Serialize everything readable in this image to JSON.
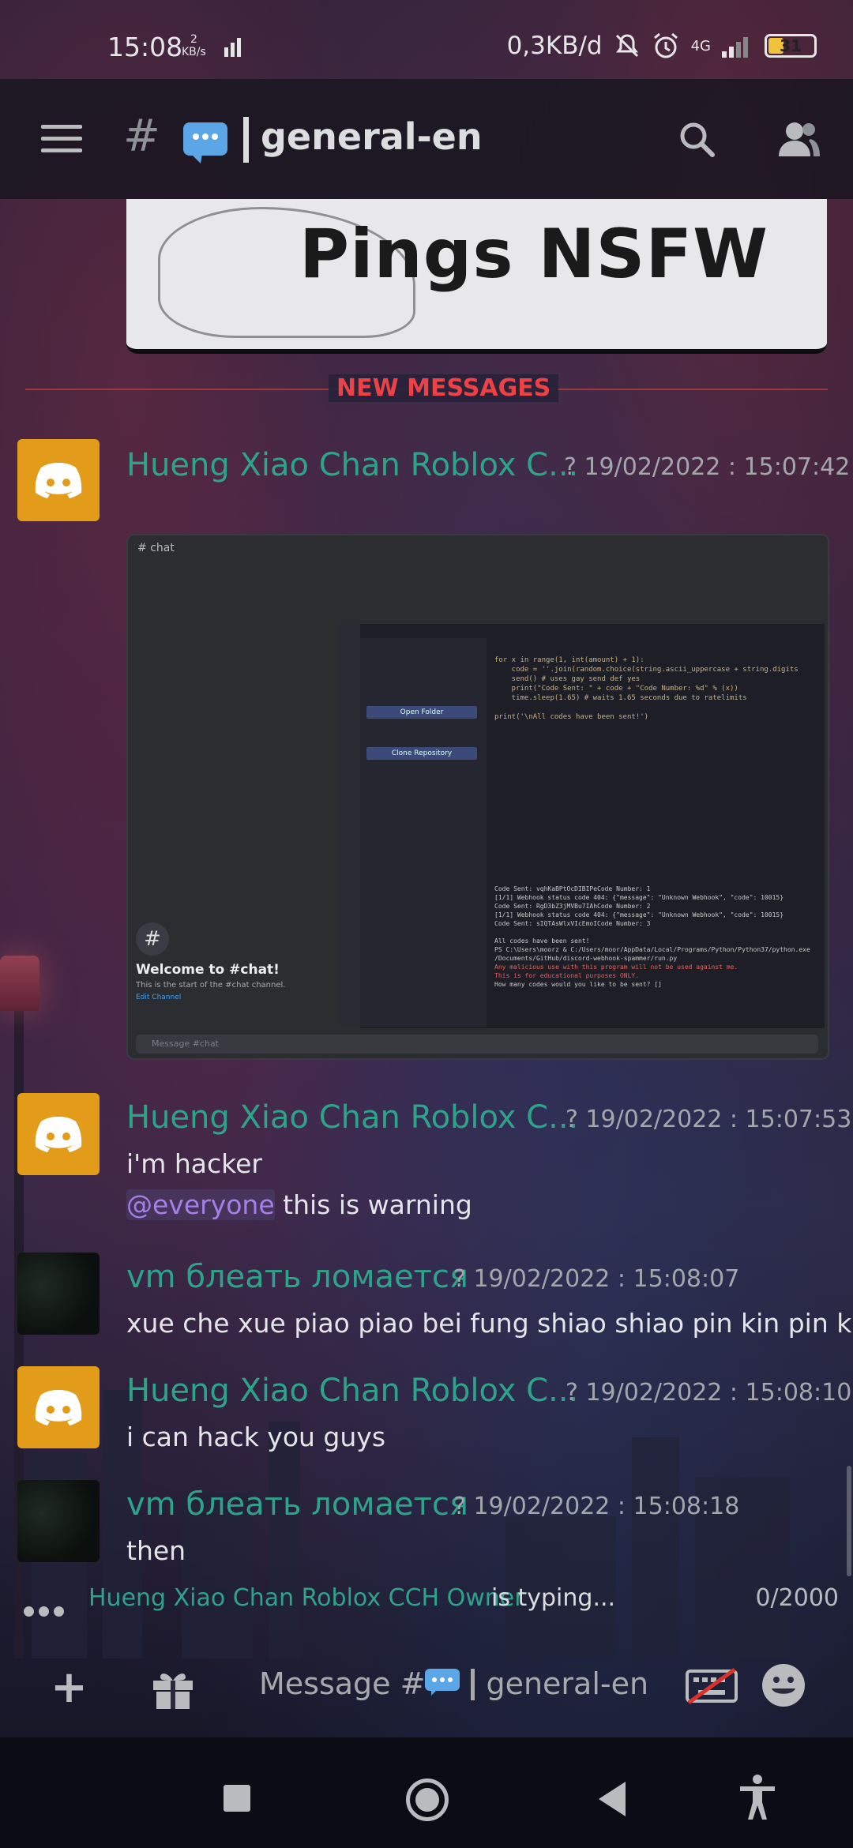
{
  "status_bar": {
    "time": "15:08",
    "kb_rate_value": "2",
    "kb_rate_unit": "KB/s",
    "data_usage": "0,3KB/d",
    "network": "4G",
    "battery": "31"
  },
  "header": {
    "hash": "#",
    "channel_name": "general-en"
  },
  "embed_top": {
    "text": "Pings NSFW"
  },
  "divider": {
    "label": "NEW MESSAGES"
  },
  "messages": [
    {
      "author": "Hueng Xiao Chan Roblox C...",
      "timestamp": "? 19/02/2022 : 15:07:42",
      "lines": []
    },
    {
      "author": "Hueng Xiao Chan Roblox C...",
      "timestamp": "? 19/02/2022 : 15:07:53",
      "lines": [
        "i'm hacker"
      ],
      "mention": "@everyone",
      "mention_rest": " this is warning"
    },
    {
      "author": "vm блеать ломается",
      "timestamp": "? 19/02/2022 : 15:08:07",
      "lines": [
        "xue che xue piao piao bei fung shiao shiao pin kin pin kin"
      ]
    },
    {
      "author": "Hueng Xiao Chan Roblox C...",
      "timestamp": "? 19/02/2022 : 15:08:10",
      "lines": [
        "i can hack you guys"
      ]
    },
    {
      "author": "vm блеать ломается",
      "timestamp": "? 19/02/2022 : 15:08:18",
      "lines": [
        "then"
      ]
    }
  ],
  "screenshot": {
    "channel": "chat",
    "welcome_title": "Welcome to #chat!",
    "welcome_sub": "This is the start of the #chat channel.",
    "edit_link": "Edit Channel",
    "input_placeholder": "Message #chat",
    "open_folder": "Open Folder",
    "clone_repo": "Clone Repository",
    "code": "for x in range(1, int(amount) + 1):\n    code = ''.join(random.choice(string.ascii_uppercase + string.digits\n    send() # uses gay send def yes\n    print(\"Code Sent: \" + code + \"Code Number: %d\" % (x))\n    time.sleep(1.65) # waits 1.65 seconds due to ratelimits\n\nprint('\\nAll codes have been sent!')",
    "terminal": "Code Sent: vqhKaBPtOcDIBIPeCode Number: 1\n[1/1] Webhook status code 404: {\"message\": \"Unknown Webhook\", \"code\": 10015}\nCode Sent: RgD3bZ3jMVBu7IAhCode Number: 2\n[1/1] Webhook status code 404: {\"message\": \"Unknown Webhook\", \"code\": 10015}\nCode Sent: sIQTAsWlxVIcEmoICode Number: 3\n\nAll codes have been sent!\nPS C:\\Users\\moorz & C:/Users/moor/AppData/Local/Programs/Python/Python37/python.exe\n/Documents/GitHub/discord-webhook-spammer/run.py",
    "terminal_red": "Any malicious use with this program will not be used against me.\nThis is for educational purposes ONLY.",
    "terminal_end": "How many codes would you like to be sent? []"
  },
  "typing": {
    "name": "Hueng Xiao Chan Roblox CCH Owner",
    "suffix": "is typing...",
    "char_count": "0/2000"
  },
  "composer": {
    "placeholder_prefix": "Message #",
    "placeholder_channel": "general-en"
  },
  "colors": {
    "author_green": "#2fa38a",
    "new_messages_red": "#ed4245",
    "mention_purple": "#a481e8",
    "discord_avatar": "#e39b1a"
  }
}
